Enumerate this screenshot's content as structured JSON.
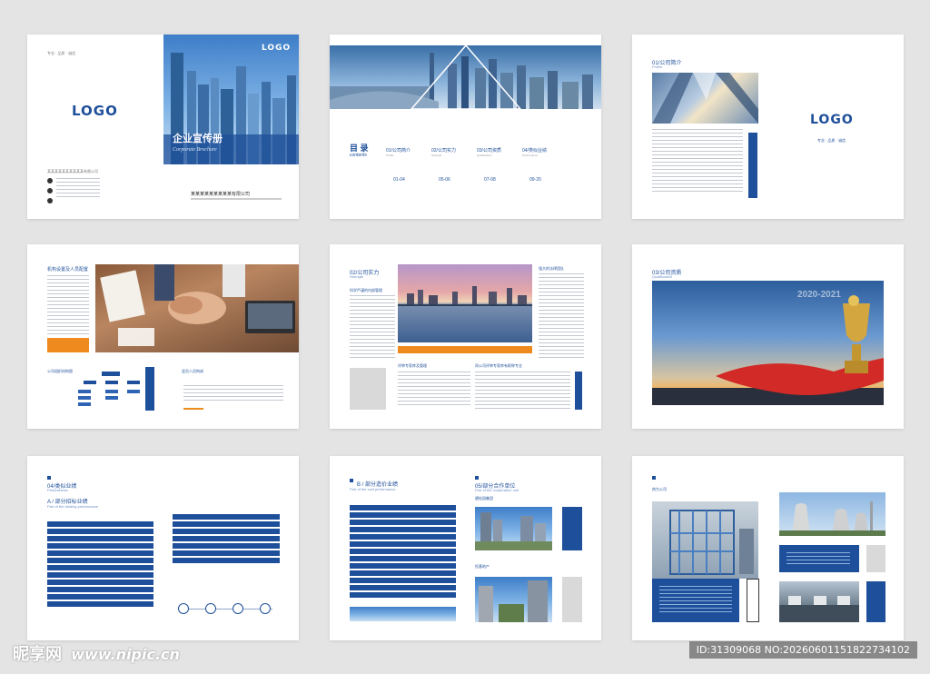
{
  "cover": {
    "logo_left": "LOGO",
    "logo_right": "LOGO",
    "title_cn": "企业宣传册",
    "title_en": "Corporate Brochure",
    "company": "某某某某某某某某某有限公司",
    "tag": "专业 · 品质 · 诚信",
    "contact_company": "某某某某某某某某某某有限公司"
  },
  "toc": {
    "title": "目 录",
    "title_en": "contents",
    "items": [
      {
        "label": "01/公司简介",
        "en": "Profile",
        "pages": "01-04"
      },
      {
        "label": "02/公司实力",
        "en": "Strength",
        "pages": "05-06"
      },
      {
        "label": "03/公司资质",
        "en": "Qualification",
        "pages": "07-08"
      },
      {
        "label": "04/类似业绩",
        "en": "Performance",
        "pages": "09-20"
      }
    ]
  },
  "intro": {
    "section": "01/公司简介",
    "section_en": "Profile",
    "logo": "LOGO",
    "tag": "专业 · 品质 · 诚信"
  },
  "org": {
    "heading": "机构设置及人员配置",
    "chart_label": "公司组织机构图",
    "members_label": "会员人员构成"
  },
  "strength": {
    "section": "02/公司实力",
    "section_en": "Strength",
    "sub1": "科学严谨的内部管理",
    "sub2": "强大的法律团队",
    "sub3": "评审专家库及管理",
    "sub4": "同公司评审专家库有职称专业"
  },
  "qual": {
    "section": "03/公司资质",
    "section_en": "Qualification",
    "year": "2020-2021"
  },
  "perf": {
    "section": "04/类似业绩",
    "section_en": "Performance",
    "sub": "A / 部分招标业绩",
    "sub_en": "Part of the bidding performance"
  },
  "perf2": {
    "sub": "B / 部分造价业绩",
    "sub_en": "Part of the cost performance",
    "coop": "05/部分合作单位",
    "coop_en": "Part of the cooperation unit",
    "coop1": "碧桂园集团",
    "coop2": "恒基地产"
  },
  "clients": {
    "heading": "热力公司"
  },
  "watermark": {
    "site": "昵享网",
    "url": "www.nipic.cn",
    "id": "ID:31309068 NO:20260601151822734102"
  }
}
